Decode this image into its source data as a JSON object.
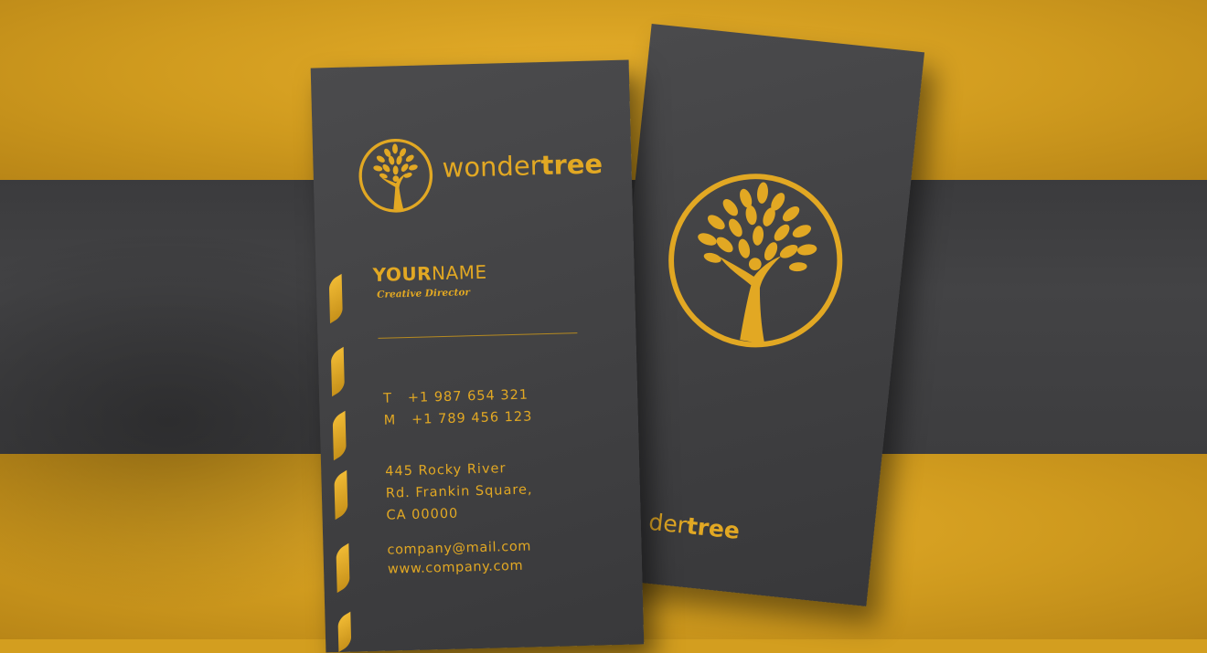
{
  "colors": {
    "gold": "#e2a823",
    "card": "#434345",
    "background": "#d39e1f"
  },
  "front": {
    "brand_light": "wonder",
    "brand_bold": "tree",
    "name_bold": "YOUR",
    "name_light": "NAME",
    "role": "Creative Director",
    "phone_t": "T   +1 987 654 321",
    "phone_m": "M   +1 789 456 123",
    "address_line1": "445 Rocky River",
    "address_line2": "Rd. Frankin Square,",
    "address_line3": "CA 00000",
    "email": "company@mail.com",
    "website": "www.company.com"
  },
  "back": {
    "brand_light": "der",
    "brand_bold": "tree"
  },
  "icons": {
    "logo": "tree-in-circle-icon"
  }
}
